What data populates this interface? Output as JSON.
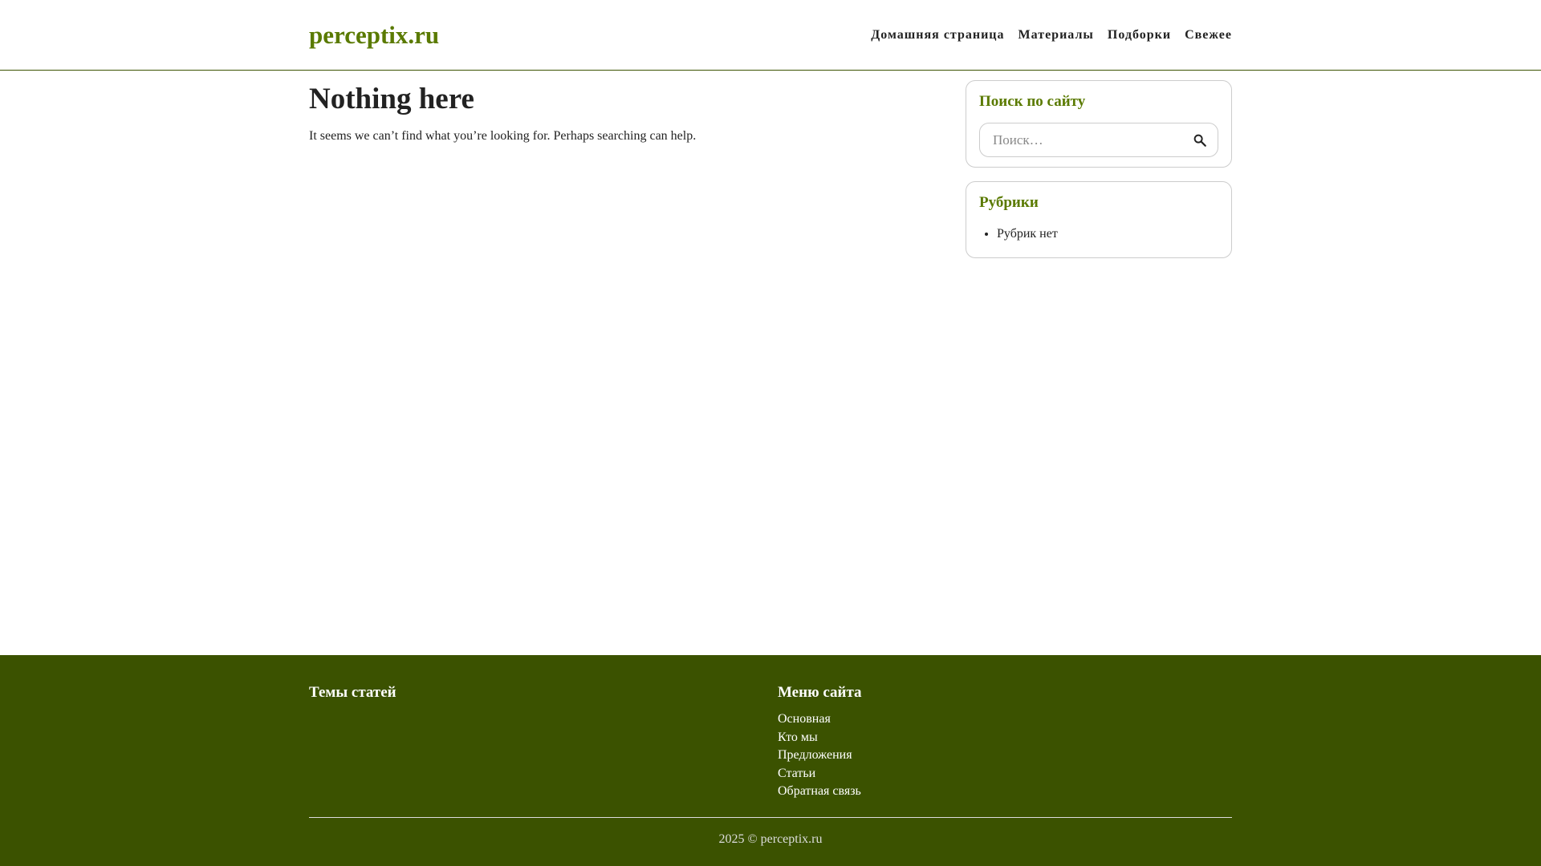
{
  "header": {
    "site_title": "perceptix.ru",
    "nav": [
      {
        "label": "Домашняя страница"
      },
      {
        "label": "Материалы"
      },
      {
        "label": "Подборки"
      },
      {
        "label": "Свежее"
      }
    ]
  },
  "main": {
    "title": "Nothing here",
    "text": "It seems we can’t find what you’re looking for. Perhaps searching can help."
  },
  "sidebar": {
    "search": {
      "title": "Поиск по сайту",
      "placeholder": "Поиск…",
      "icon": "search-icon"
    },
    "categories": {
      "title": "Рубрики",
      "items": [
        {
          "label": "Рубрик нет"
        }
      ]
    }
  },
  "footer": {
    "left_heading": "Темы статей",
    "right_heading": "Меню сайта",
    "menu": [
      {
        "label": "Основная"
      },
      {
        "label": "Кто мы"
      },
      {
        "label": "Предложения"
      },
      {
        "label": "Статьи"
      },
      {
        "label": "Обратная связь"
      }
    ],
    "copyright": "2025 © perceptix.ru"
  },
  "colors": {
    "accent": "#5a7a00",
    "footer_bg": "#3b5200",
    "text": "#222222"
  }
}
